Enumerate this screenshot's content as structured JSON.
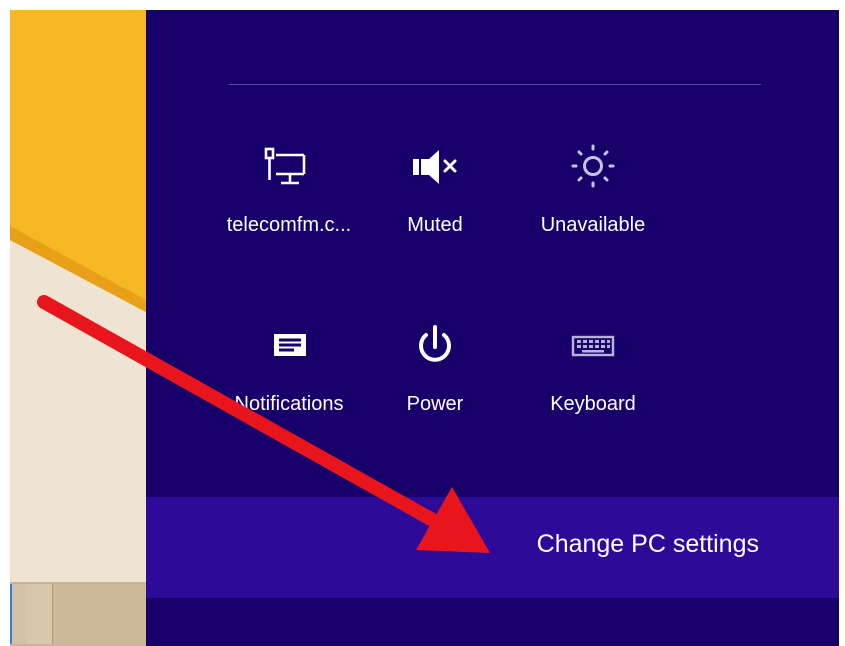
{
  "quick_settings": [
    {
      "id": "network",
      "label": "telecomfm.c...",
      "icon": "network-icon"
    },
    {
      "id": "volume",
      "label": "Muted",
      "icon": "speaker-muted-icon"
    },
    {
      "id": "brightness",
      "label": "Unavailable",
      "icon": "brightness-icon"
    },
    {
      "id": "notifications",
      "label": "Notifications",
      "icon": "notifications-icon"
    },
    {
      "id": "power",
      "label": "Power",
      "icon": "power-icon"
    },
    {
      "id": "keyboard",
      "label": "Keyboard",
      "icon": "keyboard-icon"
    }
  ],
  "footer": {
    "change_pc_settings_label": "Change PC settings"
  },
  "colors": {
    "panel_background": "#18006b",
    "footer_background": "#2e0a98",
    "tile_yellow": "#f5b724",
    "desktop_background": "#efe3d2",
    "annotation_arrow": "#e8161c"
  }
}
